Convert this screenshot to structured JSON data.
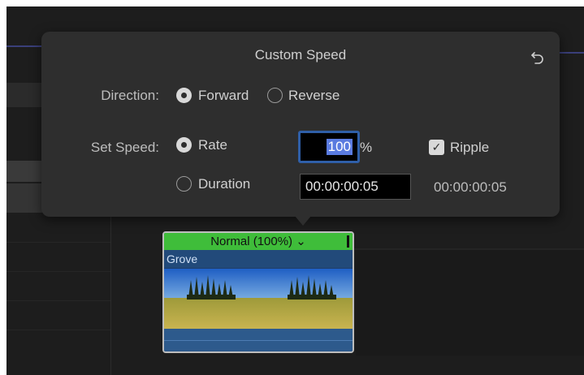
{
  "popover": {
    "title": "Custom Speed",
    "revert_icon": "revert-arrow-icon",
    "direction_label": "Direction:",
    "direction_options": [
      "Forward",
      "Reverse"
    ],
    "direction_selected": "Forward",
    "set_speed_label": "Set Speed:",
    "speed_options": [
      "Rate",
      "Duration"
    ],
    "speed_selected": "Rate",
    "rate_value": "100",
    "rate_unit": "%",
    "ripple_label": "Ripple",
    "ripple_checked": true,
    "duration_value": "00:00:00:05",
    "duration_original": "00:00:00:05"
  },
  "clip": {
    "speed_label": "Normal (100%) ⌄",
    "name": "Grove"
  },
  "colors": {
    "popover_bg": "#2e2e2e",
    "speed_bar": "#3fbd3a",
    "selection": "#5a7be0",
    "focus_ring": "#2f5fa8"
  }
}
